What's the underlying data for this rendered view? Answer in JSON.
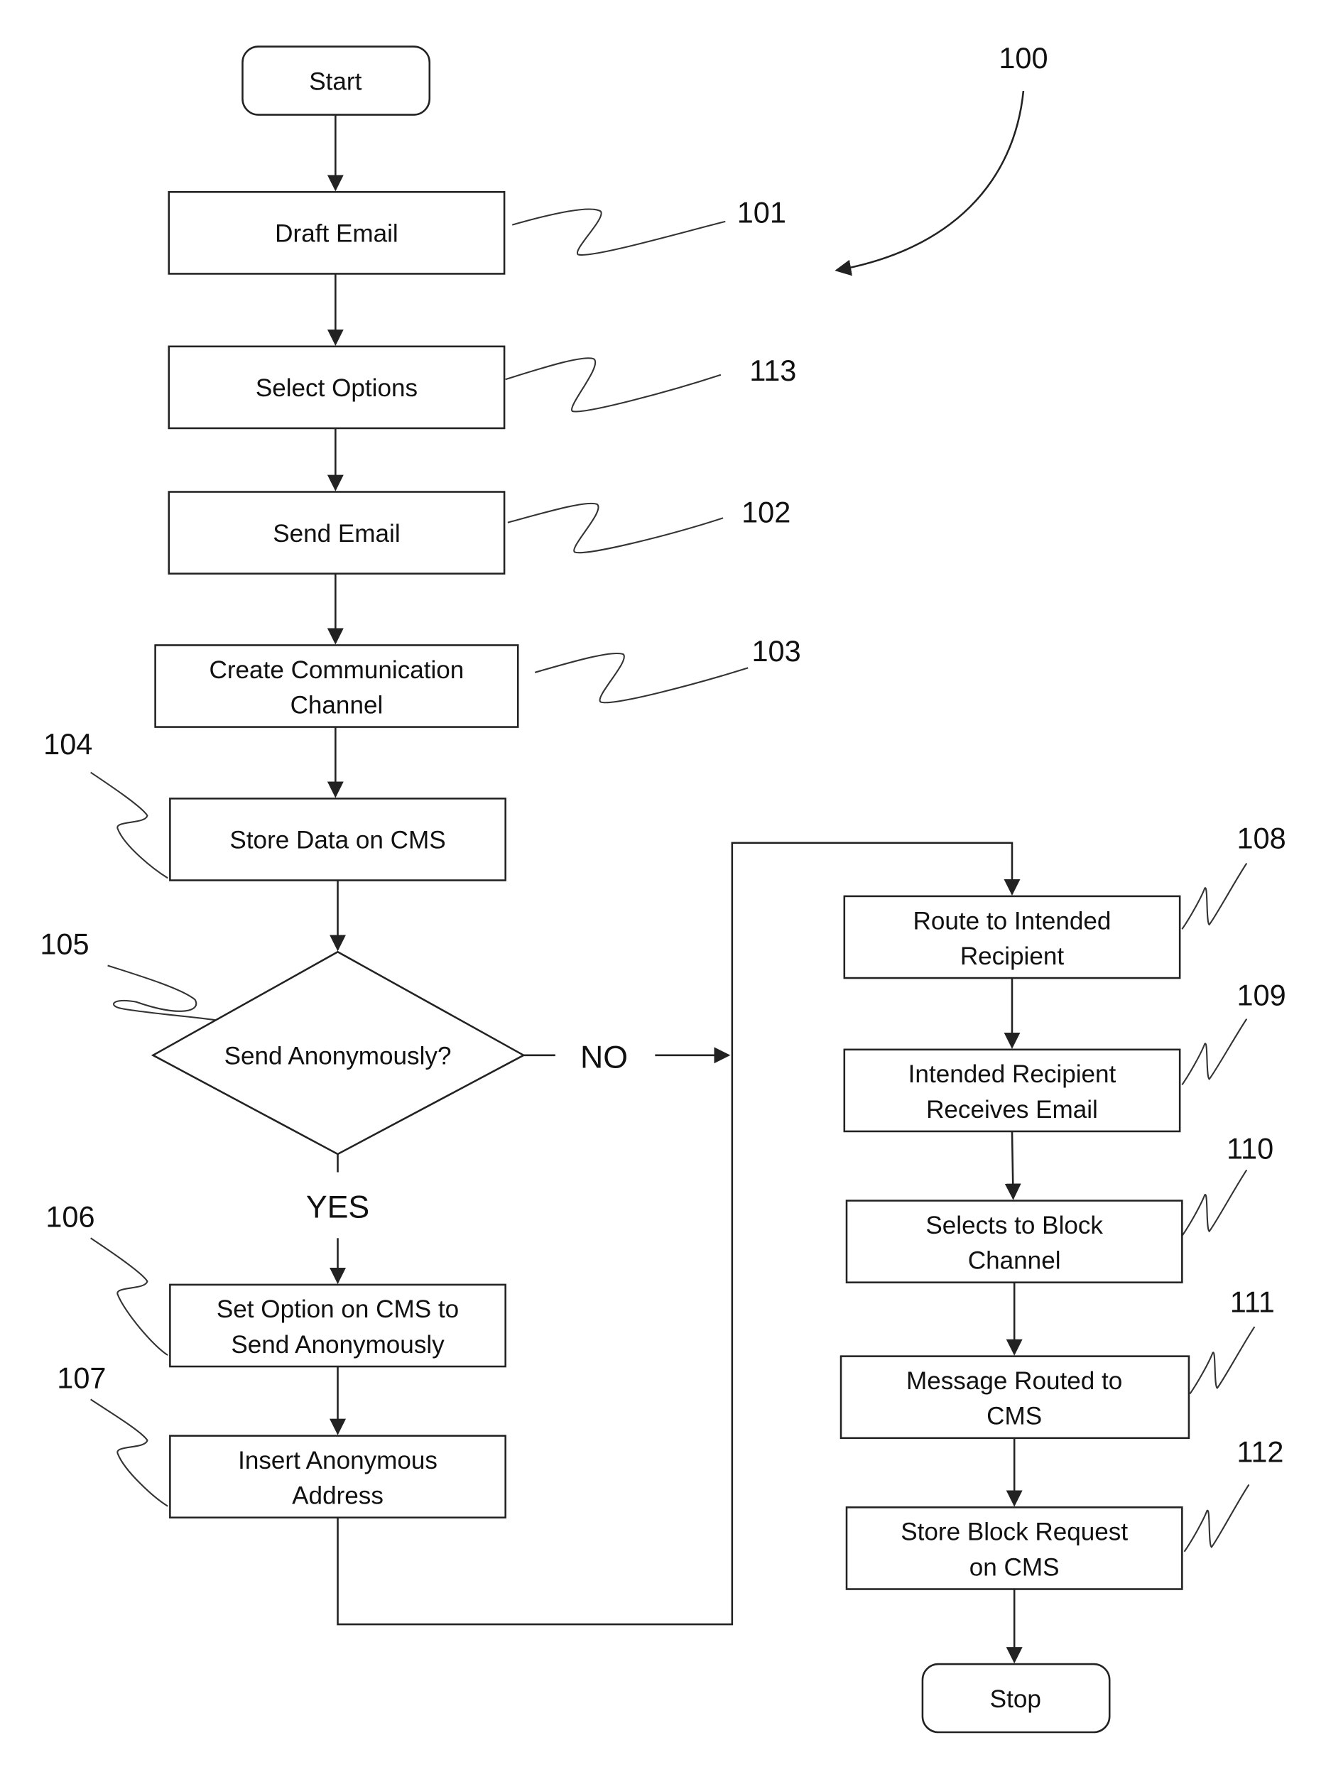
{
  "figure_ref": "100",
  "nodes": {
    "start": {
      "label": "Start"
    },
    "draft_email": {
      "label": "Draft Email",
      "ref": "101"
    },
    "select_options": {
      "label": "Select Options",
      "ref": "113"
    },
    "send_email": {
      "label": "Send Email",
      "ref": "102"
    },
    "create_channel": {
      "line1": "Create Communication",
      "line2": "Channel",
      "ref": "103"
    },
    "store_data": {
      "label": "Store Data on CMS",
      "ref": "104"
    },
    "decision": {
      "label": "Send Anonymously?",
      "ref": "105",
      "yes": "YES",
      "no": "NO"
    },
    "set_option": {
      "line1": "Set Option on CMS to",
      "line2": "Send Anonymously",
      "ref": "106"
    },
    "insert_address": {
      "line1": "Insert Anonymous",
      "line2": "Address",
      "ref": "107"
    },
    "route": {
      "line1": "Route to Intended",
      "line2": "Recipient",
      "ref": "108"
    },
    "receives": {
      "line1": "Intended Recipient",
      "line2": "Receives Email",
      "ref": "109"
    },
    "block": {
      "line1": "Selects to Block",
      "line2": "Channel",
      "ref": "110"
    },
    "routed_cms": {
      "line1": "Message Routed to",
      "line2": "CMS",
      "ref": "111"
    },
    "store_block": {
      "line1": "Store Block Request",
      "line2": "on CMS",
      "ref": "112"
    },
    "stop": {
      "label": "Stop"
    }
  }
}
